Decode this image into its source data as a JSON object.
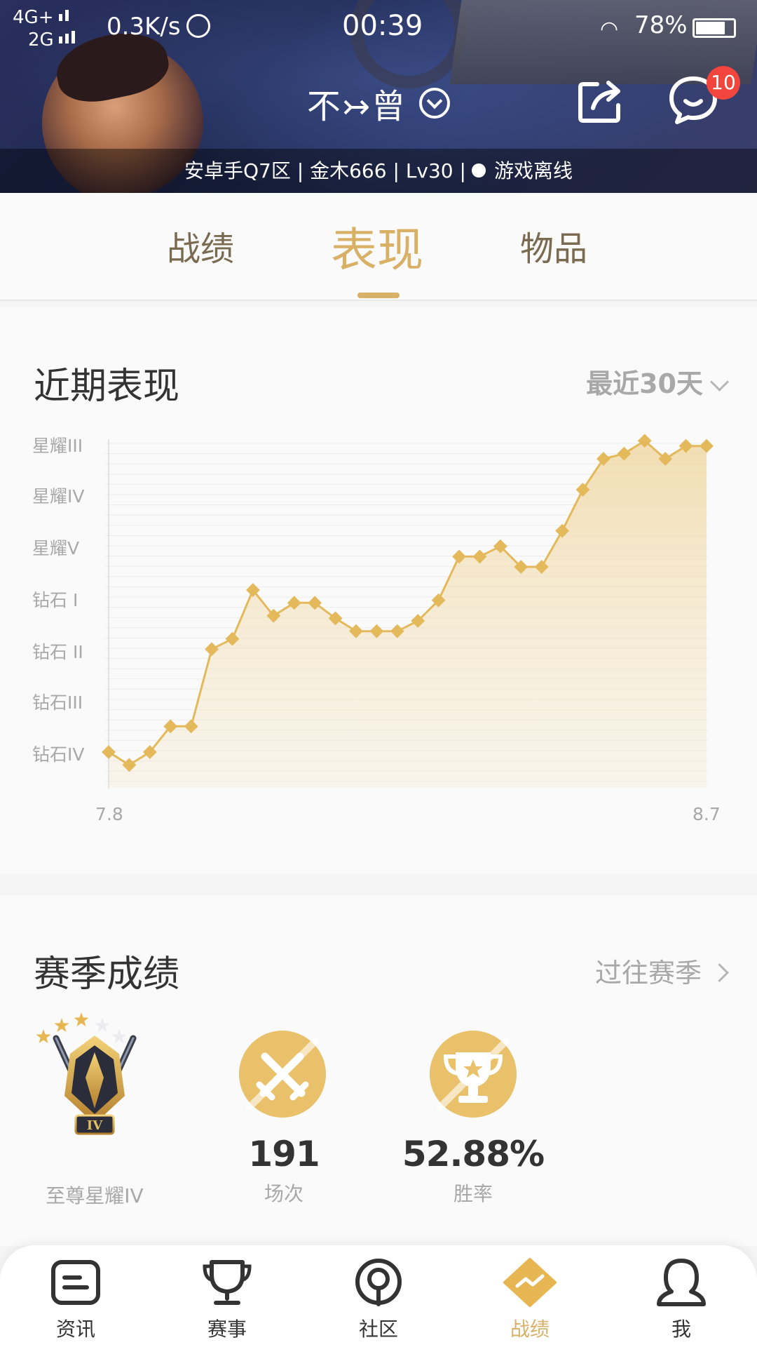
{
  "status_bar": {
    "network_top": "4G+",
    "network_bottom": "2G",
    "speed": "0.3K/s",
    "time": "00:39",
    "battery_pct": "78%",
    "battery_level": 0.78
  },
  "header": {
    "player_name": "不↣曾",
    "info_region": "安卓手Q7区",
    "info_name": "金木666",
    "info_level": "Lv30",
    "info_status": "游戏离线",
    "message_badge": "10"
  },
  "tabs": [
    {
      "label": "战绩",
      "active": false
    },
    {
      "label": "表现",
      "active": true
    },
    {
      "label": "物品",
      "active": false
    }
  ],
  "recent": {
    "title": "近期表现",
    "range_label": "最近30天"
  },
  "chart_data": {
    "type": "line",
    "title": "近期表现",
    "y_ticks": [
      "星耀III",
      "星耀IV",
      "星耀V",
      "钻石 I",
      "钻石 II",
      "钻石III",
      "钻石IV"
    ],
    "x_labels": [
      "7.8",
      "8.7"
    ],
    "ylim": [
      0,
      6.5
    ],
    "series": [
      {
        "values": [
          0.25,
          0,
          0.25,
          0.75,
          0.75,
          2.25,
          2.45,
          3.4,
          2.9,
          3.15,
          3.15,
          2.85,
          2.6,
          2.6,
          2.6,
          2.8,
          3.2,
          4.05,
          4.05,
          4.25,
          3.85,
          3.85,
          4.55,
          5.35,
          5.95,
          6.05,
          6.3,
          5.95,
          6.2,
          6.2
        ],
        "color": "#e3b95c"
      }
    ]
  },
  "season": {
    "title": "赛季成绩",
    "link_label": "过往赛季",
    "rank_name": "至尊星耀IV",
    "rank_stars": 5,
    "rank_stars_filled": 3,
    "matches_value": "191",
    "matches_label": "场次",
    "winrate_value": "52.88%",
    "winrate_label": "胜率"
  },
  "bottom_nav": [
    {
      "label": "资讯",
      "icon": "news-icon",
      "active": false
    },
    {
      "label": "赛事",
      "icon": "trophy-icon",
      "active": false
    },
    {
      "label": "社区",
      "icon": "community-icon",
      "active": false
    },
    {
      "label": "战绩",
      "icon": "stats-icon",
      "active": true
    },
    {
      "label": "我",
      "icon": "profile-icon",
      "active": false
    }
  ],
  "colors": {
    "accent": "#d8b066",
    "chart_line": "#e3b95c",
    "badge": "#f2453d"
  }
}
